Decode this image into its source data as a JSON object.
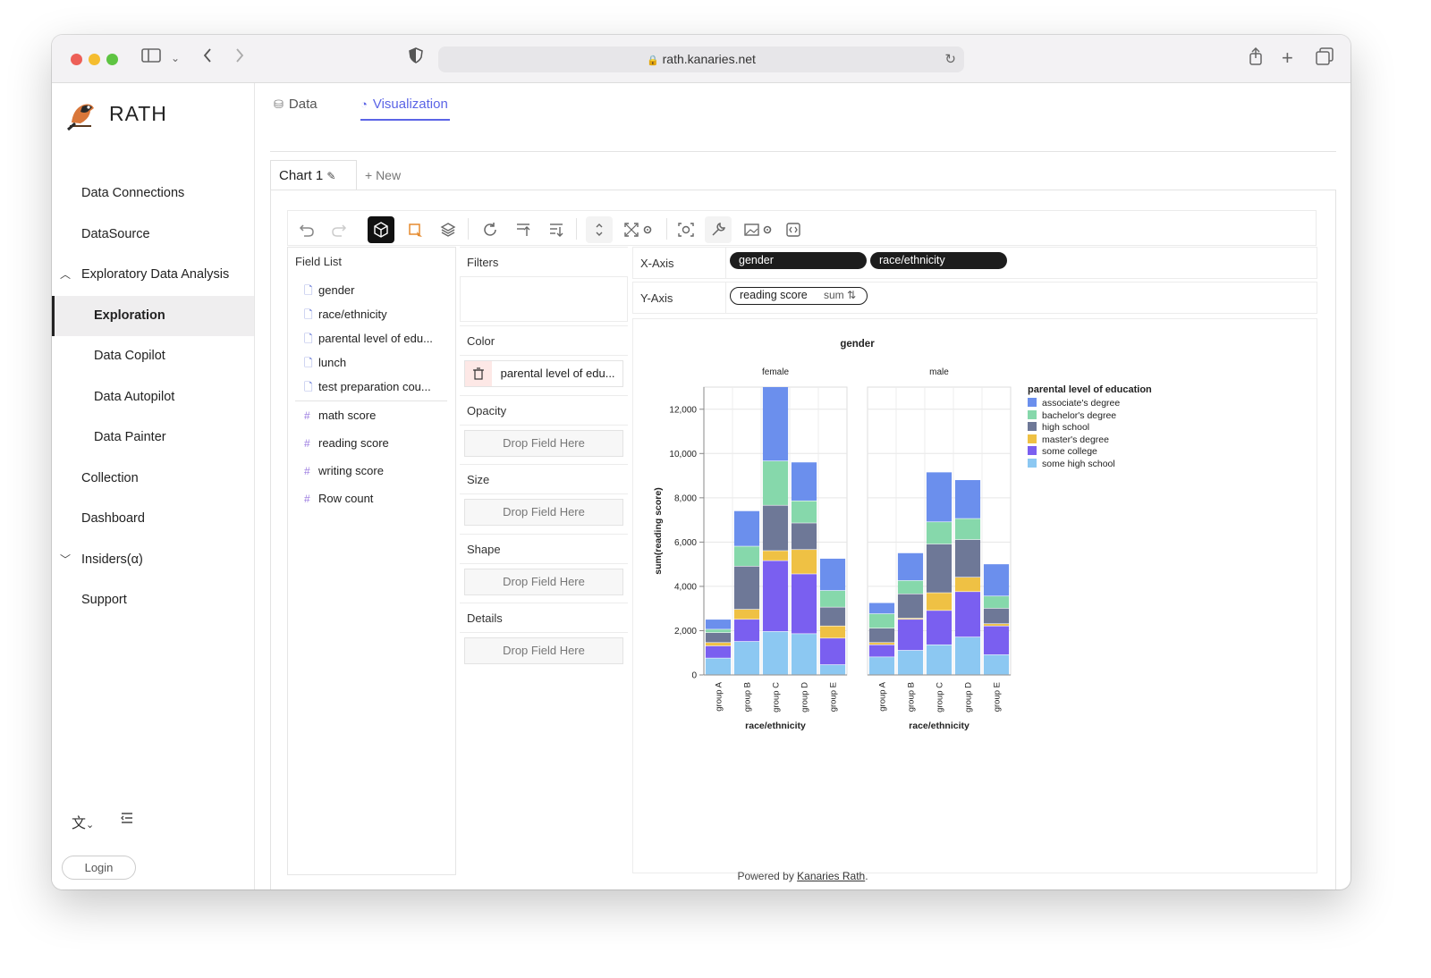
{
  "browser": {
    "url": "rath.kanaries.net"
  },
  "app": {
    "name": "RATH"
  },
  "sidebar": {
    "items": [
      {
        "label": "Data Connections"
      },
      {
        "label": "DataSource"
      },
      {
        "label": "Exploratory Data Analysis"
      },
      {
        "label": "Exploration"
      },
      {
        "label": "Data Copilot"
      },
      {
        "label": "Data Autopilot"
      },
      {
        "label": "Data Painter"
      },
      {
        "label": "Collection"
      },
      {
        "label": "Dashboard"
      },
      {
        "label": "Insiders(α)"
      },
      {
        "label": "Support"
      }
    ],
    "login_label": "Login"
  },
  "tabs": [
    {
      "label": "Data"
    },
    {
      "label": "Visualization"
    }
  ],
  "chart_tabs": {
    "current": "Chart 1",
    "new_label": "+ New"
  },
  "field_list": {
    "title": "Field List",
    "dimensions": [
      "gender",
      "race/ethnicity",
      "parental level of edu...",
      "lunch",
      "test preparation cou..."
    ],
    "measures": [
      "math score",
      "reading score",
      "writing score",
      "Row count"
    ]
  },
  "encodings": {
    "filters": "Filters",
    "color": "Color",
    "color_field": "parental level of edu...",
    "opacity": "Opacity",
    "size": "Size",
    "shape": "Shape",
    "details": "Details",
    "drop_placeholder": "Drop Field Here"
  },
  "axes": {
    "x_label": "X-Axis",
    "x_fields": [
      "gender",
      "race/ethnicity"
    ],
    "y_label": "Y-Axis",
    "y_field": "reading score",
    "y_agg": "sum"
  },
  "footer": {
    "text": "Powered by ",
    "link": "Kanaries Rath",
    "period": "."
  },
  "colors": {
    "accent": "#5b64e6",
    "dark": "#1d1d1d"
  },
  "chart_data": {
    "type": "bar",
    "stacked": true,
    "title": "gender",
    "facets": [
      "female",
      "male"
    ],
    "categories": [
      "group A",
      "group B",
      "group C",
      "group D",
      "group E"
    ],
    "xlabel": "race/ethnicity",
    "ylabel": "sum(reading score)",
    "ylim": [
      0,
      13000
    ],
    "yticks": [
      0,
      2000,
      4000,
      6000,
      8000,
      10000,
      12000
    ],
    "ytick_labels": [
      "0",
      "2,000",
      "4,000",
      "6,000",
      "8,000",
      "10,000",
      "12,000"
    ],
    "legend_title": "parental level of education",
    "legend_position": "right",
    "series": [
      {
        "name": "some high school",
        "color": "#8cc8f2",
        "female": [
          750,
          1500,
          1950,
          1850,
          450
        ],
        "male": [
          800,
          1100,
          1350,
          1700,
          900
        ]
      },
      {
        "name": "some college",
        "color": "#7a5ff0",
        "female": [
          550,
          1000,
          3200,
          2700,
          1200
        ],
        "male": [
          550,
          1400,
          1550,
          2050,
          1300
        ]
      },
      {
        "name": "master's degree",
        "color": "#efc144",
        "female": [
          150,
          450,
          450,
          1100,
          550
        ],
        "male": [
          100,
          50,
          800,
          650,
          100
        ]
      },
      {
        "name": "high school",
        "color": "#6e7897",
        "female": [
          450,
          1950,
          2050,
          1200,
          850
        ],
        "male": [
          650,
          1100,
          2200,
          1700,
          700
        ]
      },
      {
        "name": "bachelor's degree",
        "color": "#86d8ab",
        "female": [
          150,
          900,
          2000,
          1000,
          750
        ],
        "male": [
          650,
          600,
          1000,
          950,
          550
        ]
      },
      {
        "name": "associate's degree",
        "color": "#6b8fed",
        "female": [
          450,
          1600,
          3350,
          1750,
          1450
        ],
        "male": [
          500,
          1250,
          2250,
          1750,
          1450
        ]
      }
    ]
  }
}
